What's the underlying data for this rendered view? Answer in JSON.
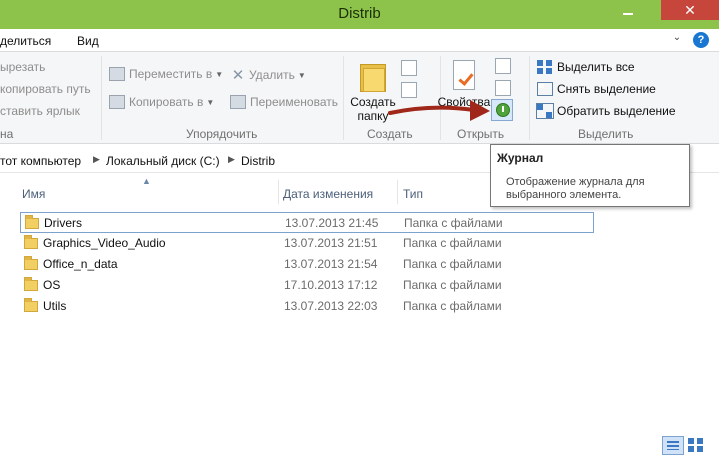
{
  "window": {
    "title": "Distrib",
    "close_glyph": "✕",
    "help_glyph": "?",
    "chevron_glyph": "⌄"
  },
  "menu": {
    "share_tab": "делиться",
    "view_tab": "Вид"
  },
  "ribbon": {
    "clipboard": {
      "cut": "ырезать",
      "copy_path": "копировать путь",
      "paste_shortcut": "ставить ярлык",
      "label": "на"
    },
    "organize": {
      "move_to": "Переместить в",
      "copy_to": "Копировать в",
      "delete": "Удалить",
      "rename": "Переименовать",
      "label": "Упорядочить"
    },
    "new": {
      "new_folder_line1": "Создать",
      "new_folder_line2": "папку",
      "label": "Создать"
    },
    "open": {
      "properties": "Свойства",
      "label": "Открыть"
    },
    "select": {
      "select_all": "Выделить все",
      "select_none": "Снять выделение",
      "invert_selection": "Обратить выделение",
      "label": "Выделить"
    }
  },
  "address": {
    "this_pc": "тот компьютер",
    "local_disk": "Локальный диск (C:)",
    "folder": "Distrib"
  },
  "columns": {
    "name": "Имя",
    "date": "Дата изменения",
    "type": "Тип"
  },
  "files": [
    {
      "name": "Drivers",
      "date": "13.07.2013 21:45",
      "type": "Папка с файлами"
    },
    {
      "name": "Graphics_Video_Audio",
      "date": "13.07.2013 21:51",
      "type": "Папка с файлами"
    },
    {
      "name": "Office_n_data",
      "date": "13.07.2013 21:54",
      "type": "Папка с файлами"
    },
    {
      "name": "OS",
      "date": "17.10.2013 17:12",
      "type": "Папка с файлами"
    },
    {
      "name": "Utils",
      "date": "13.07.2013 22:03",
      "type": "Папка с файлами"
    }
  ],
  "tooltip": {
    "title": "Журнал",
    "text": "Отображение журнала для выбранного элемента."
  },
  "colors": {
    "titlebar": "#8dc34a",
    "close": "#c7463c",
    "accent": "#3b78c4",
    "arrow": "#a0281a"
  },
  "icons": [
    "folder-icon",
    "history-icon",
    "properties-icon",
    "select-all-icon",
    "details-view-icon",
    "large-icons-view-icon",
    "delete-icon",
    "help-icon"
  ]
}
